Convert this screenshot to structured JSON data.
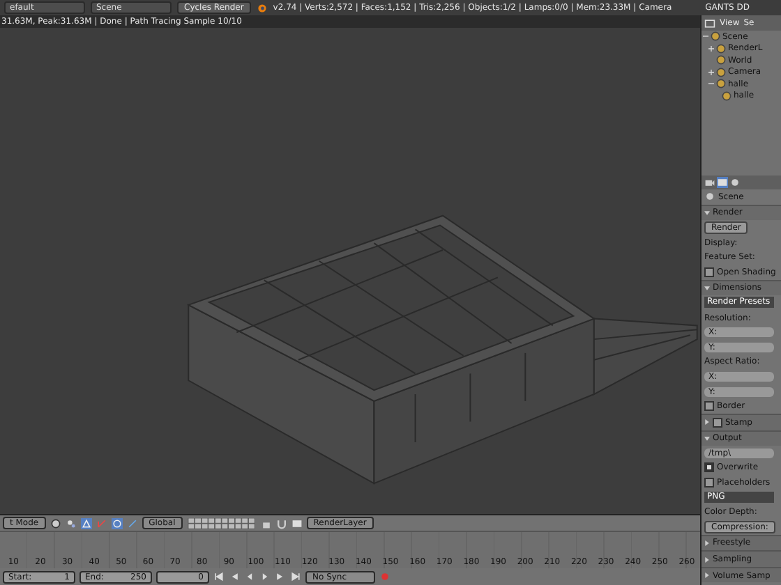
{
  "info_header": {
    "layout": "efault",
    "scene": "Scene",
    "engine": "Cycles Render",
    "stats": "v2.74 | Verts:2,572 | Faces:1,152 | Tris:2,256 | Objects:1/2 | Lamps:0/0 | Mem:23.33M | Camera",
    "extra": "GANTS DD"
  },
  "render_status": "31.63M, Peak:31.63M | Done | Path Tracing Sample 10/10",
  "outliner": {
    "header": [
      "View",
      "Se"
    ],
    "tree": [
      {
        "label": "Scene",
        "expanded": true,
        "children": [
          {
            "label": "RenderL",
            "expanded": false
          },
          {
            "label": "World"
          },
          {
            "label": "Camera",
            "expanded": false
          },
          {
            "label": "halle",
            "expanded": true,
            "children": [
              {
                "label": "halle"
              }
            ]
          }
        ]
      }
    ]
  },
  "properties": [
    {
      "kind": "context",
      "text": "Scene"
    },
    {
      "kind": "panel",
      "text": "Render",
      "expanded": true
    },
    {
      "kind": "button",
      "text": "Render"
    },
    {
      "kind": "label",
      "text": "Display:"
    },
    {
      "kind": "label",
      "text": "Feature Set:"
    },
    {
      "kind": "checkbox",
      "text": "Open Shading",
      "checked": false
    },
    {
      "kind": "panel",
      "text": "Dimensions",
      "expanded": true
    },
    {
      "kind": "menu",
      "text": "Render Presets"
    },
    {
      "kind": "label",
      "text": "Resolution:"
    },
    {
      "kind": "field",
      "text": "X:"
    },
    {
      "kind": "field",
      "text": "Y:"
    },
    {
      "kind": "label",
      "text": "Aspect Ratio:"
    },
    {
      "kind": "field",
      "text": "X:"
    },
    {
      "kind": "field",
      "text": "Y:"
    },
    {
      "kind": "checkbox",
      "text": "Border",
      "checked": false
    },
    {
      "kind": "panel",
      "text": "Stamp",
      "expanded": false,
      "checked": false
    },
    {
      "kind": "panel",
      "text": "Output",
      "expanded": true
    },
    {
      "kind": "field",
      "text": "/tmp\\"
    },
    {
      "kind": "checkbox",
      "text": "Overwrite",
      "checked": true
    },
    {
      "kind": "checkbox",
      "text": "Placeholders",
      "checked": false
    },
    {
      "kind": "menu",
      "text": "PNG"
    },
    {
      "kind": "label",
      "text": "Color Depth:"
    },
    {
      "kind": "button",
      "text": "Compression:"
    },
    {
      "kind": "panel",
      "text": "Freestyle",
      "expanded": false
    },
    {
      "kind": "panel",
      "text": "Sampling",
      "expanded": false
    },
    {
      "kind": "panel",
      "text": "Volume Samp",
      "expanded": false
    }
  ],
  "view3d_header": {
    "mode": "t Mode",
    "orientation": "Global",
    "layer": "RenderLayer"
  },
  "timeline": {
    "ticks": [
      "10",
      "20",
      "30",
      "40",
      "50",
      "60",
      "70",
      "80",
      "90",
      "100",
      "110",
      "120",
      "130",
      "140",
      "150",
      "160",
      "170",
      "180",
      "190",
      "200",
      "210",
      "220",
      "230",
      "240",
      "250",
      "260"
    ]
  },
  "timeline_header": {
    "start_label": "Start:",
    "start": "1",
    "end_label": "End:",
    "end": "250",
    "frame": "0",
    "sync": "No Sync"
  }
}
